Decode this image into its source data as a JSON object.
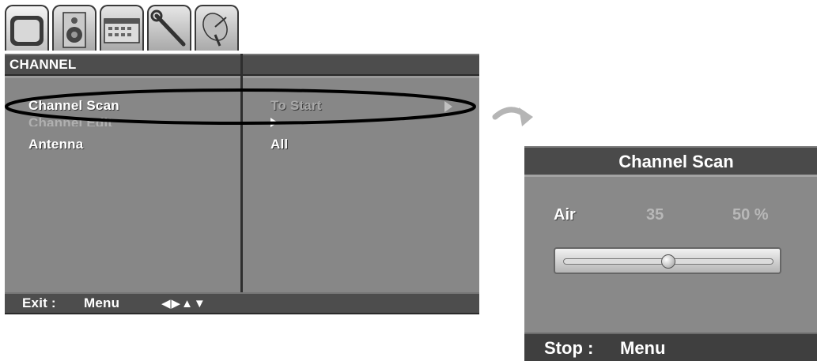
{
  "tabs": [
    {
      "icon": "tv-icon"
    },
    {
      "icon": "speaker-icon"
    },
    {
      "icon": "calendar-icon"
    },
    {
      "icon": "wrench-icon"
    },
    {
      "icon": "satellite-dish-icon"
    }
  ],
  "menu": {
    "title": "CHANNEL",
    "items": [
      {
        "label": "Channel Scan",
        "value": "To Start"
      },
      {
        "label": "Channel Edit",
        "value": ""
      },
      {
        "label": "Antenna",
        "value": "All"
      }
    ],
    "footer": {
      "exit_label": "Exit :",
      "menu_label": "Menu",
      "nav_glyphs": "◀▶▲▼"
    }
  },
  "scan": {
    "title": "Channel Scan",
    "source": "Air",
    "channel": "35",
    "percent": "50 %",
    "progress": 0.5,
    "footer": {
      "stop_label": "Stop :",
      "menu_label": "Menu"
    }
  },
  "colors": {
    "bar": "#4d4d4d",
    "body": "#878787",
    "highlight": "#ffffff",
    "dim_text": "#a8a8a8"
  }
}
